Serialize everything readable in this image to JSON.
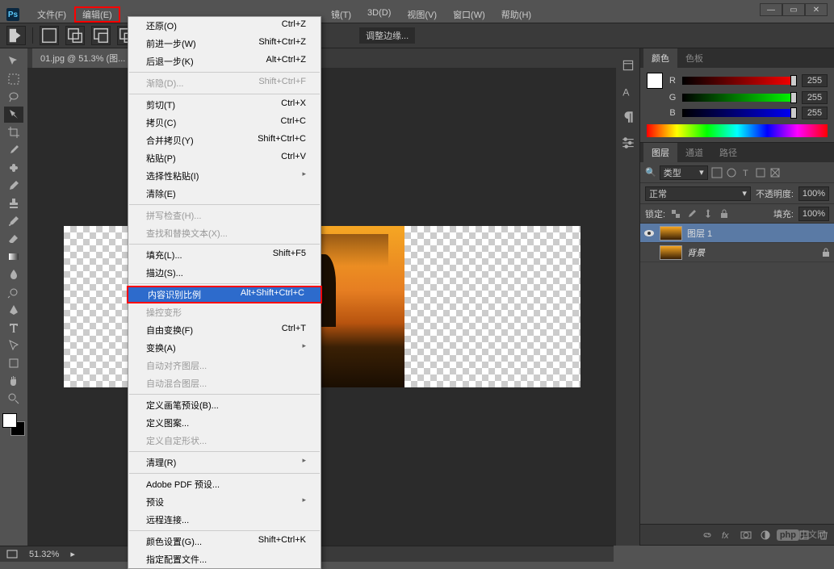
{
  "app_logo": "Ps",
  "menubar": [
    "文件(F)",
    "编辑(E)",
    "镜(T)",
    "3D(D)",
    "视图(V)",
    "窗口(W)",
    "帮助(H)"
  ],
  "menubar_highlight_index": 1,
  "optionbar": {
    "refine_edge": "调整边缘..."
  },
  "doc_tab": "01.jpg @ 51.3% (图...",
  "edit_menu": [
    {
      "type": "item",
      "label": "还原(O)",
      "shortcut": "Ctrl+Z"
    },
    {
      "type": "item",
      "label": "前进一步(W)",
      "shortcut": "Shift+Ctrl+Z"
    },
    {
      "type": "item",
      "label": "后退一步(K)",
      "shortcut": "Alt+Ctrl+Z"
    },
    {
      "type": "sep"
    },
    {
      "type": "item",
      "label": "渐隐(D)...",
      "shortcut": "Shift+Ctrl+F",
      "disabled": true
    },
    {
      "type": "sep"
    },
    {
      "type": "item",
      "label": "剪切(T)",
      "shortcut": "Ctrl+X"
    },
    {
      "type": "item",
      "label": "拷贝(C)",
      "shortcut": "Ctrl+C"
    },
    {
      "type": "item",
      "label": "合并拷贝(Y)",
      "shortcut": "Shift+Ctrl+C"
    },
    {
      "type": "item",
      "label": "粘贴(P)",
      "shortcut": "Ctrl+V"
    },
    {
      "type": "item",
      "label": "选择性粘贴(I)",
      "sub": true
    },
    {
      "type": "item",
      "label": "清除(E)"
    },
    {
      "type": "sep"
    },
    {
      "type": "item",
      "label": "拼写检查(H)...",
      "disabled": true
    },
    {
      "type": "item",
      "label": "查找和替换文本(X)...",
      "disabled": true
    },
    {
      "type": "sep"
    },
    {
      "type": "item",
      "label": "填充(L)...",
      "shortcut": "Shift+F5"
    },
    {
      "type": "item",
      "label": "描边(S)..."
    },
    {
      "type": "sep"
    },
    {
      "type": "item",
      "label": "内容识别比例",
      "shortcut": "Alt+Shift+Ctrl+C",
      "highlight": true,
      "boxed": true
    },
    {
      "type": "item",
      "label": "操控变形",
      "disabled": true
    },
    {
      "type": "item",
      "label": "自由变换(F)",
      "shortcut": "Ctrl+T"
    },
    {
      "type": "item",
      "label": "变换(A)",
      "sub": true
    },
    {
      "type": "item",
      "label": "自动对齐图层...",
      "disabled": true
    },
    {
      "type": "item",
      "label": "自动混合图层...",
      "disabled": true
    },
    {
      "type": "sep"
    },
    {
      "type": "item",
      "label": "定义画笔预设(B)..."
    },
    {
      "type": "item",
      "label": "定义图案..."
    },
    {
      "type": "item",
      "label": "定义自定形状...",
      "disabled": true
    },
    {
      "type": "sep"
    },
    {
      "type": "item",
      "label": "清理(R)",
      "sub": true
    },
    {
      "type": "sep"
    },
    {
      "type": "item",
      "label": "Adobe PDF 预设..."
    },
    {
      "type": "item",
      "label": "预设",
      "sub": true
    },
    {
      "type": "item",
      "label": "远程连接..."
    },
    {
      "type": "sep"
    },
    {
      "type": "item",
      "label": "颜色设置(G)...",
      "shortcut": "Shift+Ctrl+K"
    },
    {
      "type": "item",
      "label": "指定配置文件..."
    }
  ],
  "color_panel": {
    "tab_color": "颜色",
    "tab_swatch": "色板",
    "r_label": "R",
    "g_label": "G",
    "b_label": "B",
    "r_val": "255",
    "g_val": "255",
    "b_val": "255"
  },
  "layers_panel": {
    "tab_layers": "图层",
    "tab_channels": "通道",
    "tab_paths": "路径",
    "type_label": "类型",
    "blend_mode": "正常",
    "opacity_label": "不透明度:",
    "opacity_val": "100%",
    "lock_label": "锁定:",
    "fill_label": "填充:",
    "fill_val": "100%",
    "layers": [
      {
        "name": "图层 1",
        "visible": true,
        "selected": true
      },
      {
        "name": "背景",
        "visible": false,
        "locked": true,
        "italic": true
      }
    ]
  },
  "statusbar": {
    "zoom": "51.32%"
  },
  "watermark": {
    "php": "php",
    "cn": "中文网"
  },
  "icons": {
    "search": "🔍",
    "dropdown": "▾",
    "arrow": "▸"
  }
}
